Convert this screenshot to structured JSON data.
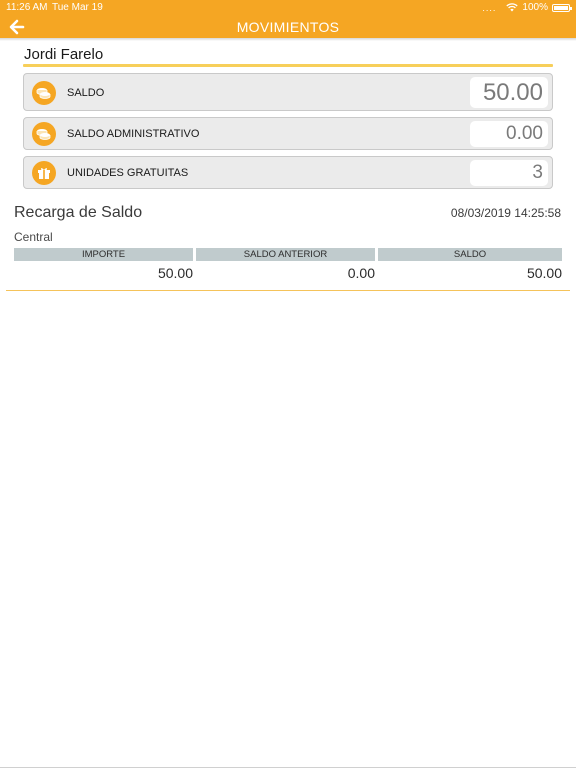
{
  "status_bar": {
    "time": "11:26 AM",
    "date": "Tue Mar 19",
    "dots": "....",
    "battery": "100%"
  },
  "nav": {
    "title": "MOVIMIENTOS",
    "back_icon": "arrow-left-icon"
  },
  "user": {
    "name": "Jordi Farelo"
  },
  "balances": [
    {
      "label": "SALDO",
      "value": "50.00",
      "icon": "coins-icon"
    },
    {
      "label": "SALDO ADMINISTRATIVO",
      "value": "0.00",
      "icon": "coins-icon"
    },
    {
      "label": "UNIDADES GRATUITAS",
      "value": "3",
      "icon": "gift-icon"
    }
  ],
  "movement": {
    "title": "Recarga de Saldo",
    "datetime": "08/03/2019 14:25:58",
    "origin": "Central",
    "columns": [
      "IMPORTE",
      "SALDO ANTERIOR",
      "SALDO"
    ],
    "values": [
      "50.00",
      "0.00",
      "50.00"
    ]
  },
  "colors": {
    "accent": "#f5a623",
    "underline": "#f7cf5a",
    "header_cell": "#c0cbcd",
    "card_bg": "#ebebeb"
  }
}
